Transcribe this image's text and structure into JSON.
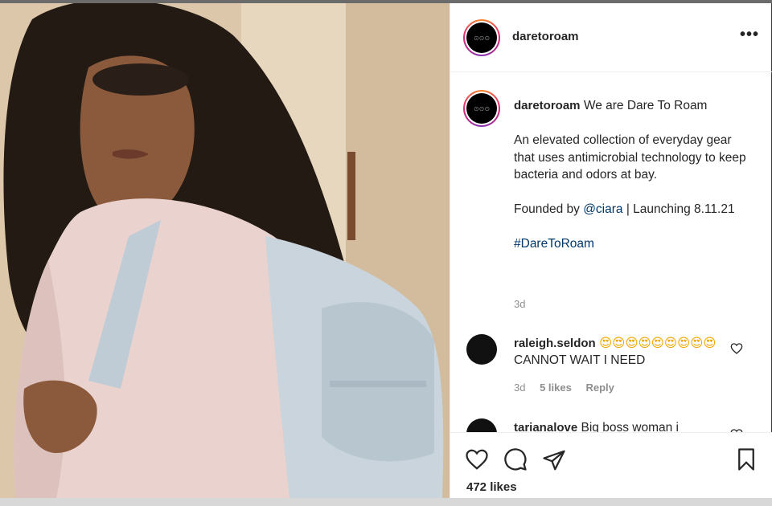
{
  "post": {
    "username": "daretoroam",
    "avatar_text": "⊙⊙⊙",
    "more_label": "•••",
    "caption_user": "daretoroam",
    "caption_title": "We are Dare To Roam",
    "caption_body": "An elevated collection of everyday gear that uses antimicrobial technology to keep bacteria and odors at bay.",
    "founded_prefix": "Founded by ",
    "founded_mention": "@ciara",
    "founded_suffix": " | Launching 8.11.21",
    "hashtag": "#DareToRoam",
    "age": "3d"
  },
  "comments": [
    {
      "username": "raleigh.seldon",
      "emojis": "😍😍😍😍😍😍😍😍😍",
      "text": " CANNOT WAIT I NEED",
      "age": "3d",
      "likes": "5 likes",
      "reply": "Reply"
    },
    {
      "username": "tarianalove",
      "text": " Big boss woman i"
    }
  ],
  "actions": {
    "likes_count": "472 likes"
  },
  "colors": {
    "link": "#00376b",
    "text": "#262626",
    "muted": "#8e8e8e"
  }
}
